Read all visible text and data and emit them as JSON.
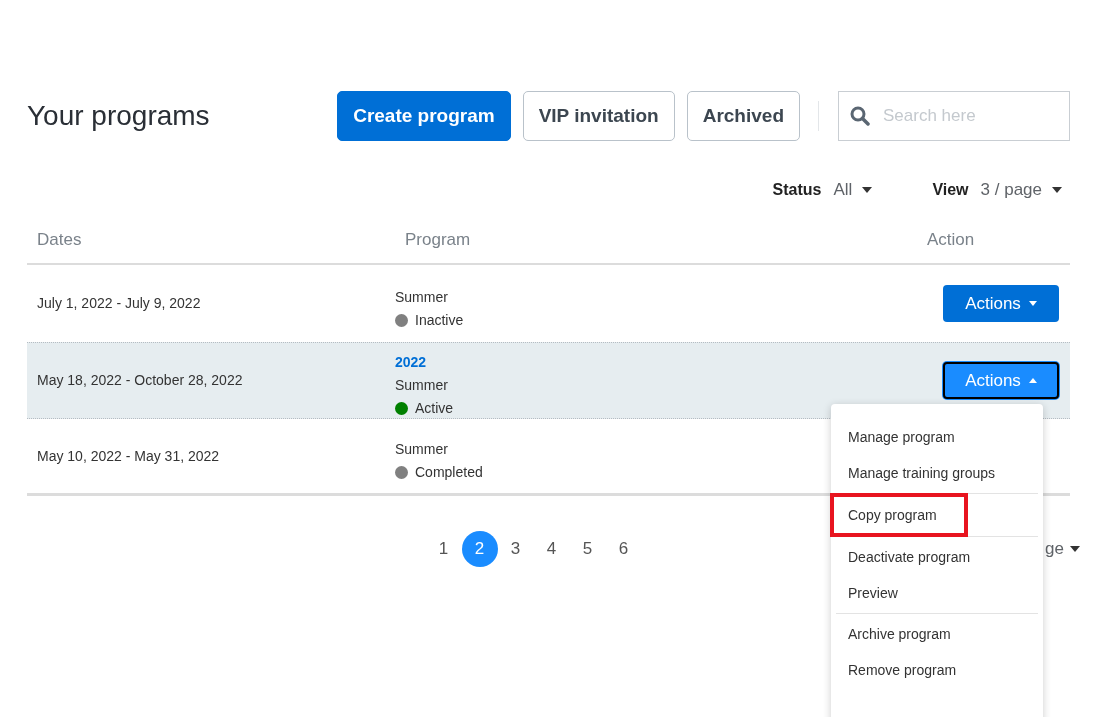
{
  "title": "Your programs",
  "toolbar": {
    "buttons": [
      {
        "label": "Create program",
        "kind": "primary"
      },
      {
        "label": "VIP invitation",
        "kind": "outline"
      },
      {
        "label": "Archived",
        "kind": "outline"
      }
    ],
    "search": {
      "placeholder": "Search here"
    }
  },
  "filters": [
    {
      "label": "Status",
      "value": "All"
    },
    {
      "label": "View",
      "value": "3 / page"
    }
  ],
  "table": {
    "columns": [
      "Dates",
      "Program",
      "Action"
    ],
    "rows": [
      {
        "dates": "July 1, 2022 - July 9, 2022",
        "year": null,
        "program": "Summer",
        "status": "Inactive",
        "color": "#808080",
        "selected": false,
        "action": "Actions",
        "expanded": false
      },
      {
        "dates": "May 18, 2022 - October 28, 2022",
        "year": "2022",
        "program": "Summer",
        "status": "Active",
        "color": "#008000",
        "selected": true,
        "action": "Actions",
        "expanded": true
      },
      {
        "dates": "May 10, 2022 - May 31, 2022",
        "year": null,
        "program": "Summer",
        "status": "Completed",
        "color": "#808080",
        "selected": false
      }
    ]
  },
  "pagination": [
    {
      "label": "1",
      "selected": false
    },
    {
      "label": "2",
      "selected": true
    },
    {
      "label": "3",
      "selected": false
    },
    {
      "label": "4",
      "selected": false
    },
    {
      "label": "5",
      "selected": false
    },
    {
      "label": "6",
      "selected": false
    }
  ],
  "bottom_view_select": "ge",
  "menu": {
    "groups": [
      [
        {
          "label": "Manage program",
          "highlighted": false
        },
        {
          "label": "Manage training groups",
          "highlighted": false
        }
      ],
      [
        {
          "label": "Copy program",
          "highlighted": true
        }
      ],
      [
        {
          "label": "Deactivate program",
          "highlighted": false
        },
        {
          "label": "Preview",
          "highlighted": false
        }
      ],
      [
        {
          "label": "Archive program",
          "highlighted": false
        },
        {
          "label": "Remove program",
          "highlighted": false
        }
      ]
    ]
  }
}
